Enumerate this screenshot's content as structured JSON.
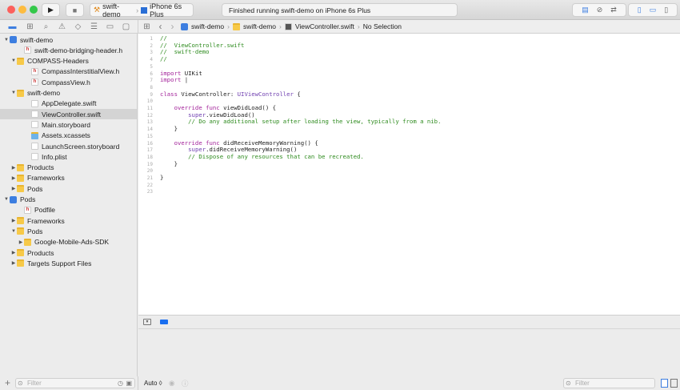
{
  "toolbar": {
    "scheme": "swift-demo",
    "device": "iPhone 6s Plus",
    "status": "Finished running swift-demo on iPhone 6s Plus"
  },
  "jumpbar": {
    "items": [
      "swift-demo",
      "swift-demo",
      "ViewController.swift",
      "No Selection"
    ]
  },
  "navigator": {
    "items": [
      {
        "label": "swift-demo",
        "type": "proj",
        "indent": 0,
        "tri": "▼"
      },
      {
        "label": "swift-demo-bridging-header.h",
        "type": "hfile",
        "indent": 2,
        "tri": ""
      },
      {
        "label": "COMPASS-Headers",
        "type": "folder",
        "indent": 1,
        "tri": "▼"
      },
      {
        "label": "CompassInterstitialView.h",
        "type": "hfile",
        "indent": 3,
        "tri": ""
      },
      {
        "label": "CompassView.h",
        "type": "hfile",
        "indent": 3,
        "tri": ""
      },
      {
        "label": "swift-demo",
        "type": "folder",
        "indent": 1,
        "tri": "▼"
      },
      {
        "label": "AppDelegate.swift",
        "type": "swift",
        "indent": 3,
        "tri": ""
      },
      {
        "label": "ViewController.swift",
        "type": "swift",
        "indent": 3,
        "tri": "",
        "selected": true
      },
      {
        "label": "Main.storyboard",
        "type": "swift",
        "indent": 3,
        "tri": ""
      },
      {
        "label": "Assets.xcassets",
        "type": "assets",
        "indent": 3,
        "tri": ""
      },
      {
        "label": "LaunchScreen.storyboard",
        "type": "swift",
        "indent": 3,
        "tri": ""
      },
      {
        "label": "Info.plist",
        "type": "swift",
        "indent": 3,
        "tri": ""
      },
      {
        "label": "Products",
        "type": "folder",
        "indent": 1,
        "tri": "▶"
      },
      {
        "label": "Frameworks",
        "type": "folder",
        "indent": 1,
        "tri": "▶"
      },
      {
        "label": "Pods",
        "type": "folder",
        "indent": 1,
        "tri": "▶"
      },
      {
        "label": "Pods",
        "type": "proj",
        "indent": 0,
        "tri": "▼"
      },
      {
        "label": "Podfile",
        "type": "hfile",
        "indent": 2,
        "tri": ""
      },
      {
        "label": "Frameworks",
        "type": "folder",
        "indent": 1,
        "tri": "▶"
      },
      {
        "label": "Pods",
        "type": "folder",
        "indent": 1,
        "tri": "▼"
      },
      {
        "label": "Google-Mobile-Ads-SDK",
        "type": "folder",
        "indent": 2,
        "tri": "▶"
      },
      {
        "label": "Products",
        "type": "folder",
        "indent": 1,
        "tri": "▶"
      },
      {
        "label": "Targets Support Files",
        "type": "folder",
        "indent": 1,
        "tri": "▶"
      }
    ]
  },
  "code": [
    [
      [
        "cm",
        "//"
      ]
    ],
    [
      [
        "cm",
        "//  ViewController.swift"
      ]
    ],
    [
      [
        "cm",
        "//  swift-demo"
      ]
    ],
    [
      [
        "cm",
        "//"
      ]
    ],
    [],
    [
      [
        "kw",
        "import"
      ],
      [
        "",
        "UIKit"
      ]
    ],
    [
      [
        "kw",
        "import"
      ],
      [
        "",
        "|"
      ]
    ],
    [],
    [
      [
        "kw",
        "class"
      ],
      [
        "",
        " ViewController: "
      ],
      [
        "ty",
        "UIViewController"
      ],
      [
        "",
        " {"
      ]
    ],
    [],
    [
      [
        "",
        "    "
      ],
      [
        "kw",
        "override func"
      ],
      [
        "",
        " viewDidLoad() {"
      ]
    ],
    [
      [
        "",
        "        "
      ],
      [
        "ty",
        "super"
      ],
      [
        "",
        ".viewDidLoad()"
      ]
    ],
    [
      [
        "",
        "        "
      ],
      [
        "cm",
        "// Do any additional setup after loading the view, typically from a nib."
      ]
    ],
    [
      [
        "",
        "    }"
      ]
    ],
    [],
    [
      [
        "",
        "    "
      ],
      [
        "kw",
        "override func"
      ],
      [
        "",
        " didReceiveMemoryWarning() {"
      ]
    ],
    [
      [
        "",
        "        "
      ],
      [
        "ty",
        "super"
      ],
      [
        "",
        ".didReceiveMemoryWarning()"
      ]
    ],
    [
      [
        "",
        "        "
      ],
      [
        "cm",
        "// Dispose of any resources that can be recreated."
      ]
    ],
    [
      [
        "",
        "    }"
      ]
    ],
    [],
    [
      [
        "",
        "}"
      ]
    ],
    [],
    []
  ],
  "bottom": {
    "filter_placeholder": "Filter",
    "auto_label": "Auto ◊",
    "console_filter_placeholder": "Filter"
  },
  "colors": {
    "accent": "#3d7ee0",
    "keyword": "#a3239a",
    "comment": "#2e8b1e"
  }
}
